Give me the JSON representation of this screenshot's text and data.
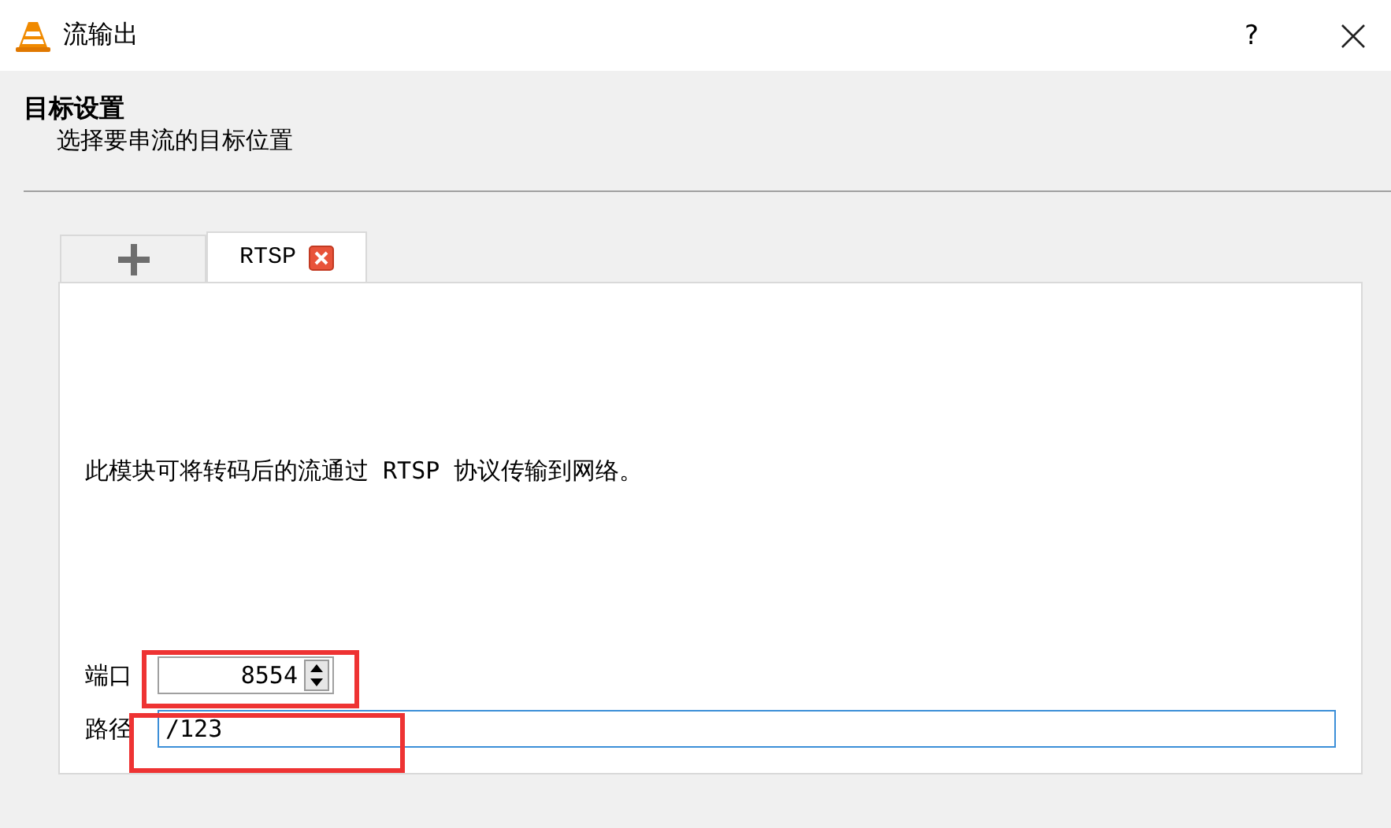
{
  "window": {
    "title": "流输出",
    "help": "?"
  },
  "header": {
    "title": "目标设置",
    "subtitle": "选择要串流的目标位置"
  },
  "tabs": [
    {
      "kind": "add",
      "selected": false
    },
    {
      "kind": "module",
      "label": "RTSP",
      "selected": true
    }
  ],
  "panel": {
    "description": "此模块可将转码后的流通过 RTSP 协议传输到网络。",
    "port": {
      "label": "端口",
      "value": "8554"
    },
    "path": {
      "label": "路径",
      "value": "/123"
    }
  }
}
